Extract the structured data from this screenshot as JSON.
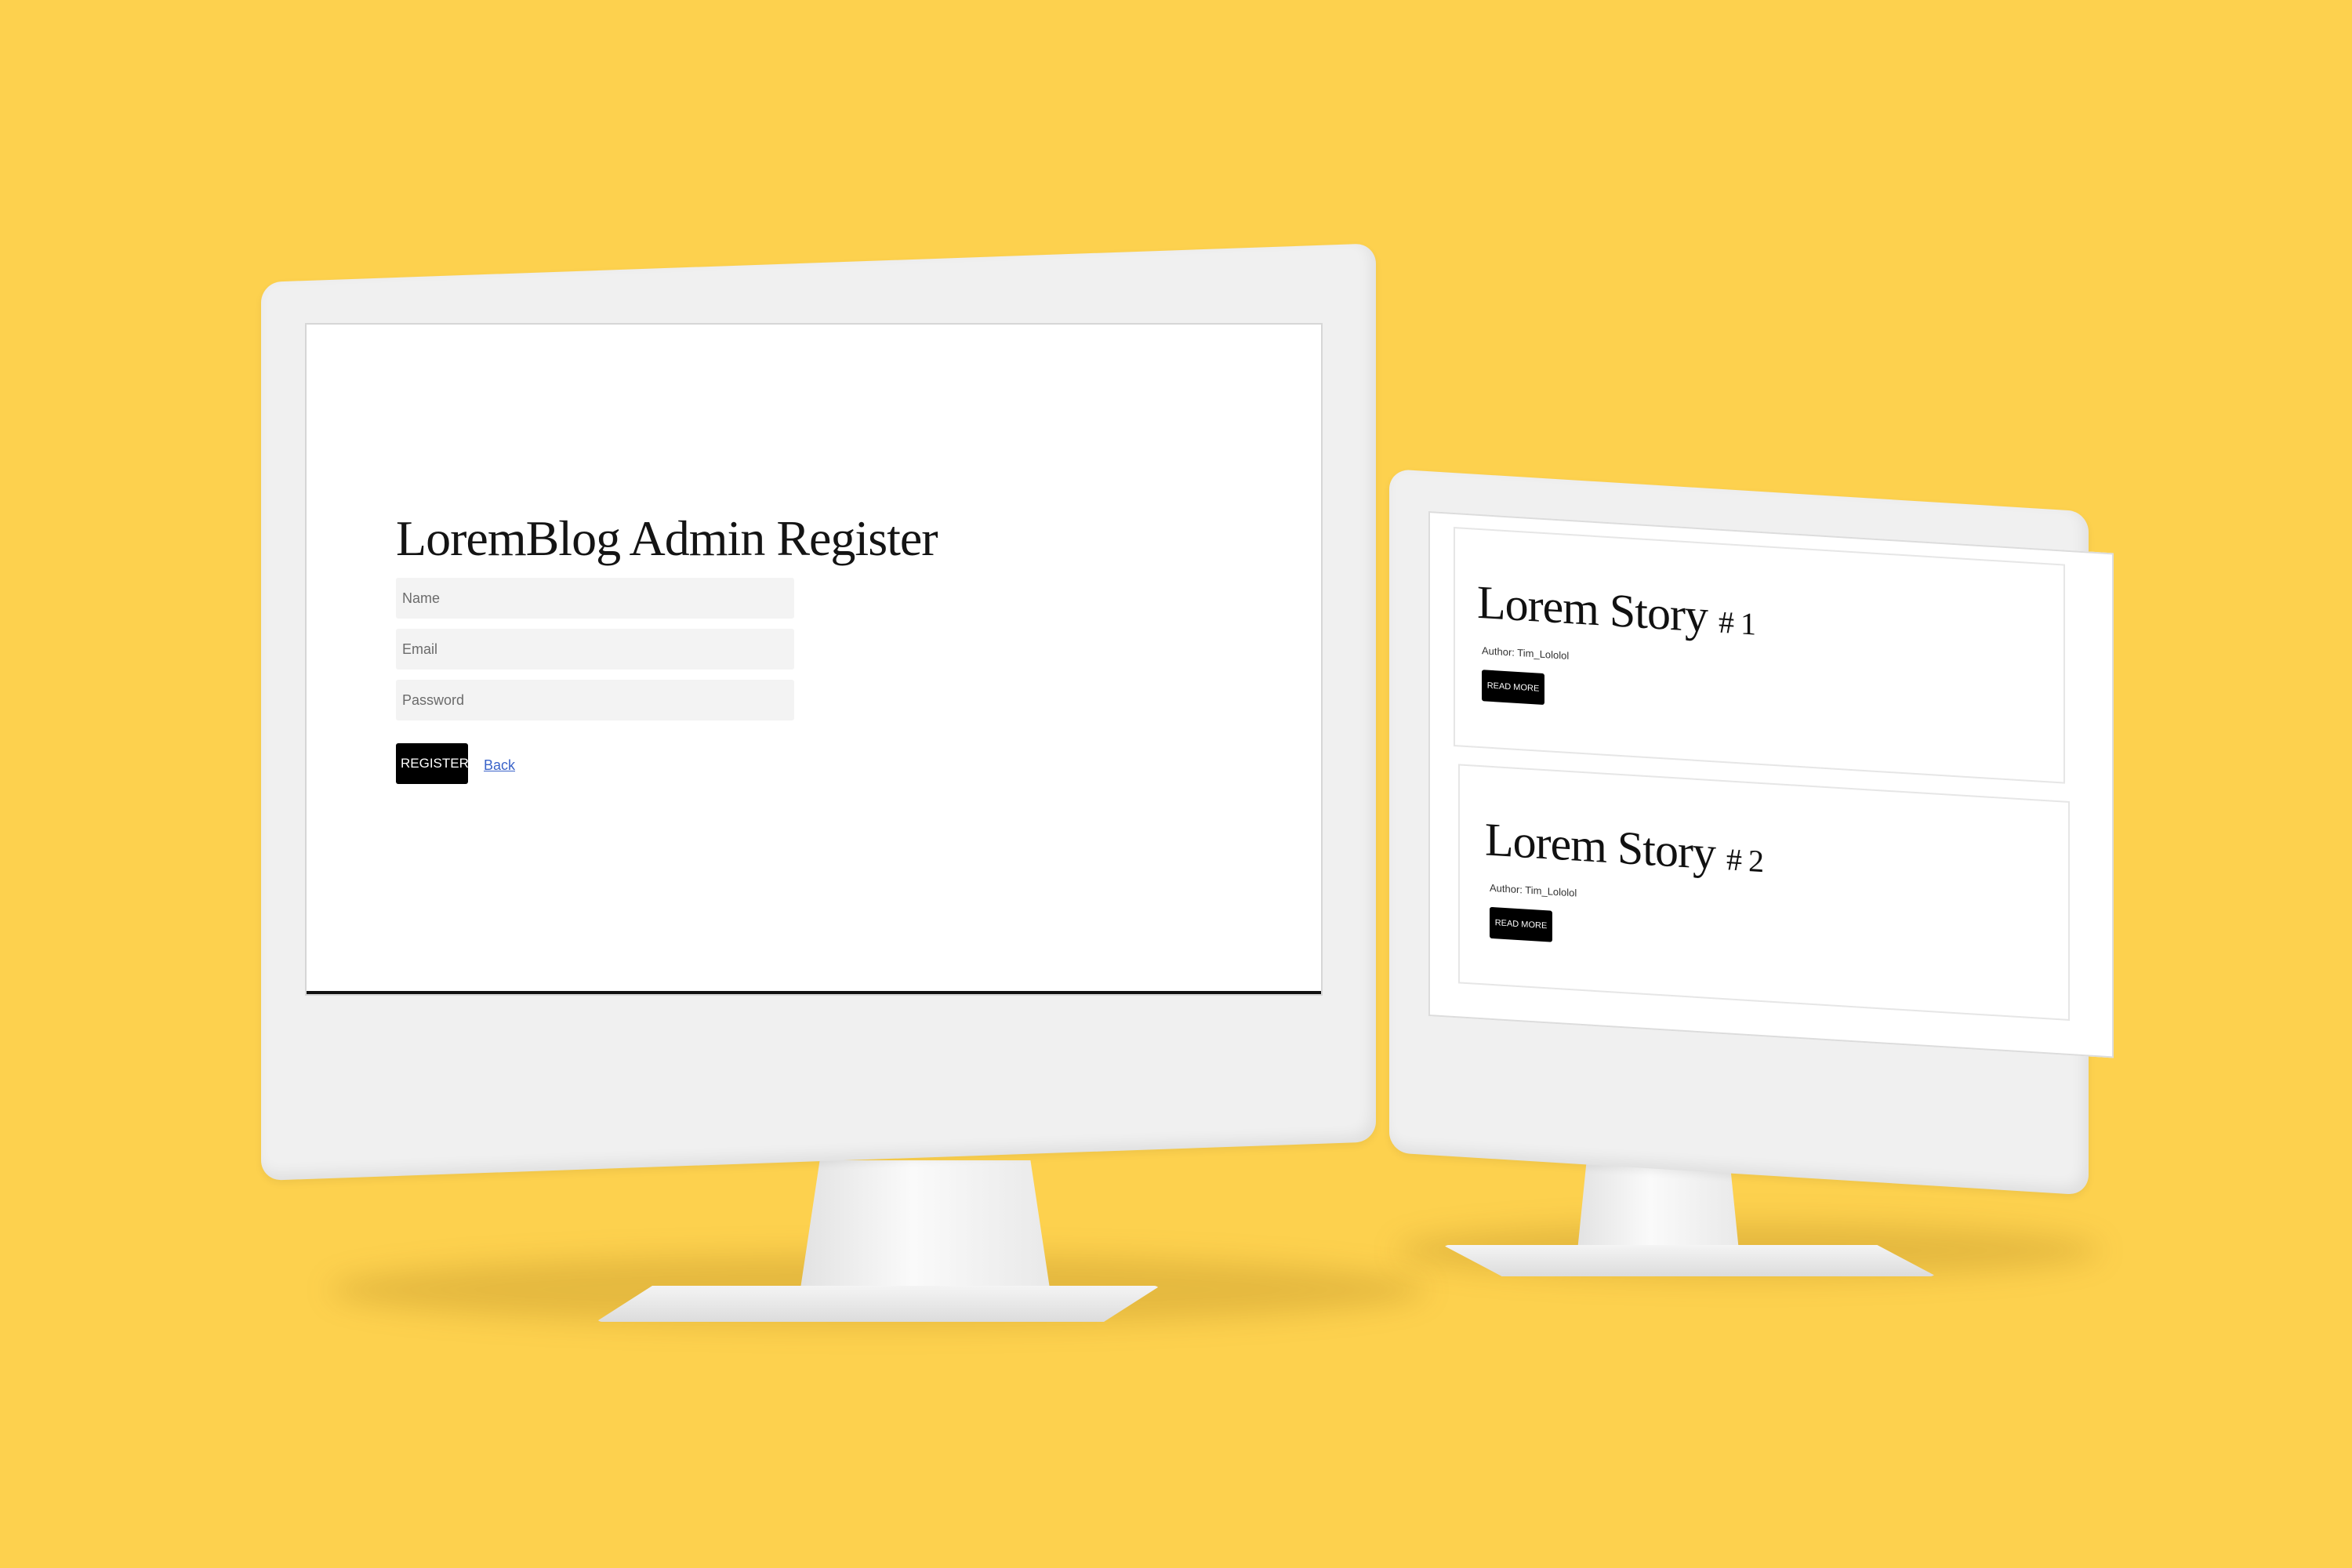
{
  "left_screen": {
    "title": "LoremBlog Admin Register",
    "form": {
      "name_placeholder": "Name",
      "email_placeholder": "Email",
      "password_placeholder": "Password",
      "register_label": "REGISTER",
      "back_label": "Back"
    }
  },
  "right_screen": {
    "stories": [
      {
        "title": "Lorem Story",
        "number": "# 1",
        "author": "Author: Tim_Lololol",
        "button": "READ MORE"
      },
      {
        "title": "Lorem Story",
        "number": "# 2",
        "author": "Author: Tim_Lololol",
        "button": "READ MORE"
      }
    ]
  },
  "colors": {
    "background": "#fdd14e",
    "button": "#000000",
    "link": "#3a63c9"
  }
}
